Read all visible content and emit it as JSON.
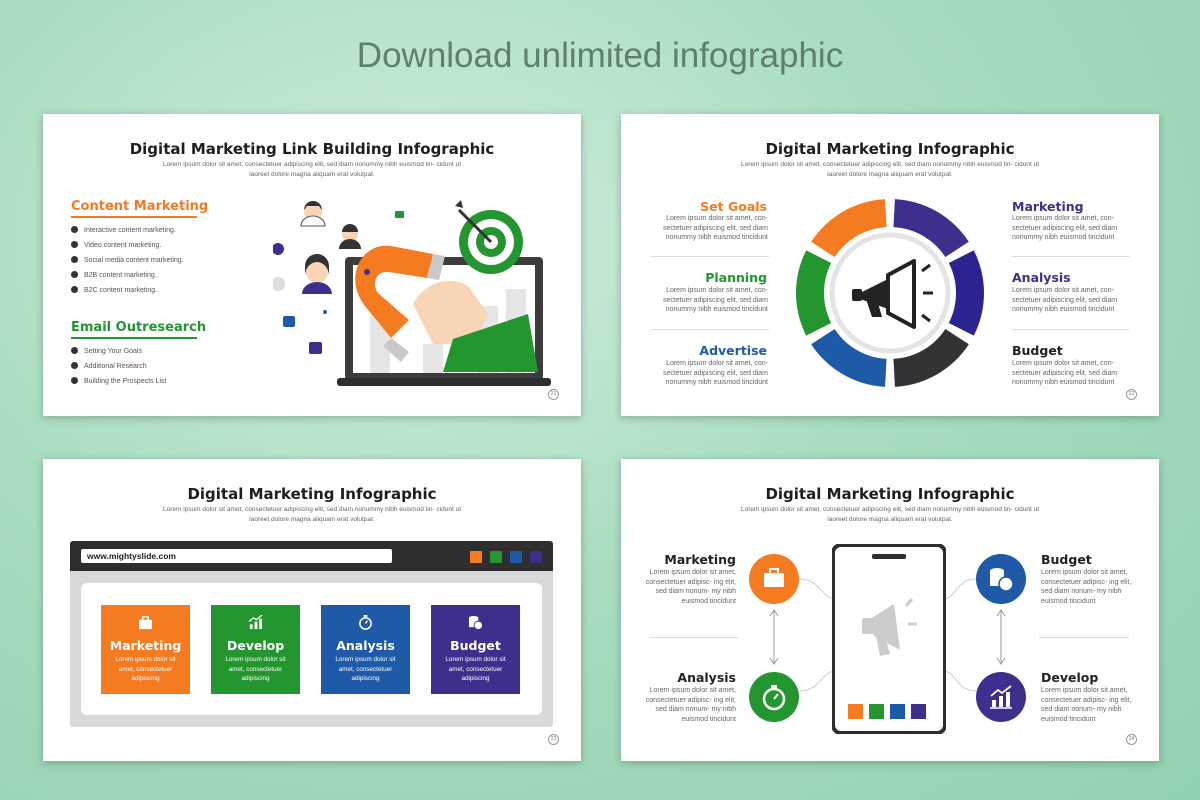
{
  "banner": "Download unlimited infographic",
  "lorem_sub": "Lorem ipsum dolor sit amet, consectetuer adipiscing elit, sed diam nonummy nibh euismod tin- cidunt ut laoreet dolore magna aliquam erat volutpat.",
  "lorem_short": "Lorem ipsum dolor sit amet, con- sectetuer adipiscing elit, sed diam nonummy nibh euismod tincidunt",
  "lorem_card": "Lorem ipsum dolor sit amet, consectetuer adipiscing",
  "lorem_s4": "Lorem ipsum dolor sit amet, consectetuer adipisc- ing elit, sed diam nonum- my nibh euismod tincidunt",
  "slide1": {
    "title": "Digital Marketing Link Building Infographic",
    "content_heading": "Content Marketing",
    "content_items": [
      "Interactive content marketing.",
      "Video content marketing.",
      "Social media content marketing.",
      "B2B content marketing.",
      "B2C content marketing."
    ],
    "email_heading": "Email Outresearch",
    "email_items": [
      "Setting Your Goals",
      "Additional Research",
      "Building the Prospects List"
    ],
    "page": "21"
  },
  "slide2": {
    "title": "Digital Marketing Infographic",
    "left": [
      "Set Goals",
      "Planning",
      "Advertise"
    ],
    "right": [
      "Marketing",
      "Analysis",
      "Budget"
    ],
    "page": "22"
  },
  "slide3": {
    "title": "Digital Marketing Infographic",
    "url": "www.mightyslide.com",
    "cards": [
      "Marketing",
      "Develop",
      "Analysis",
      "Budget"
    ],
    "page": "23"
  },
  "slide4": {
    "title": "Digital Marketing Infographic",
    "left": [
      "Marketing",
      "Analysis"
    ],
    "right": [
      "Budget",
      "Develop"
    ],
    "page": "24"
  },
  "colors": {
    "orange": "#f47b20",
    "green": "#24962f",
    "blue": "#1e5aa8",
    "purple": "#3f2f8c",
    "dark": "#333333"
  },
  "icons": [
    "megaphone-icon",
    "magnet-icon",
    "target-icon",
    "briefcase-icon",
    "stopwatch-icon",
    "coins-icon",
    "chart-icon"
  ]
}
